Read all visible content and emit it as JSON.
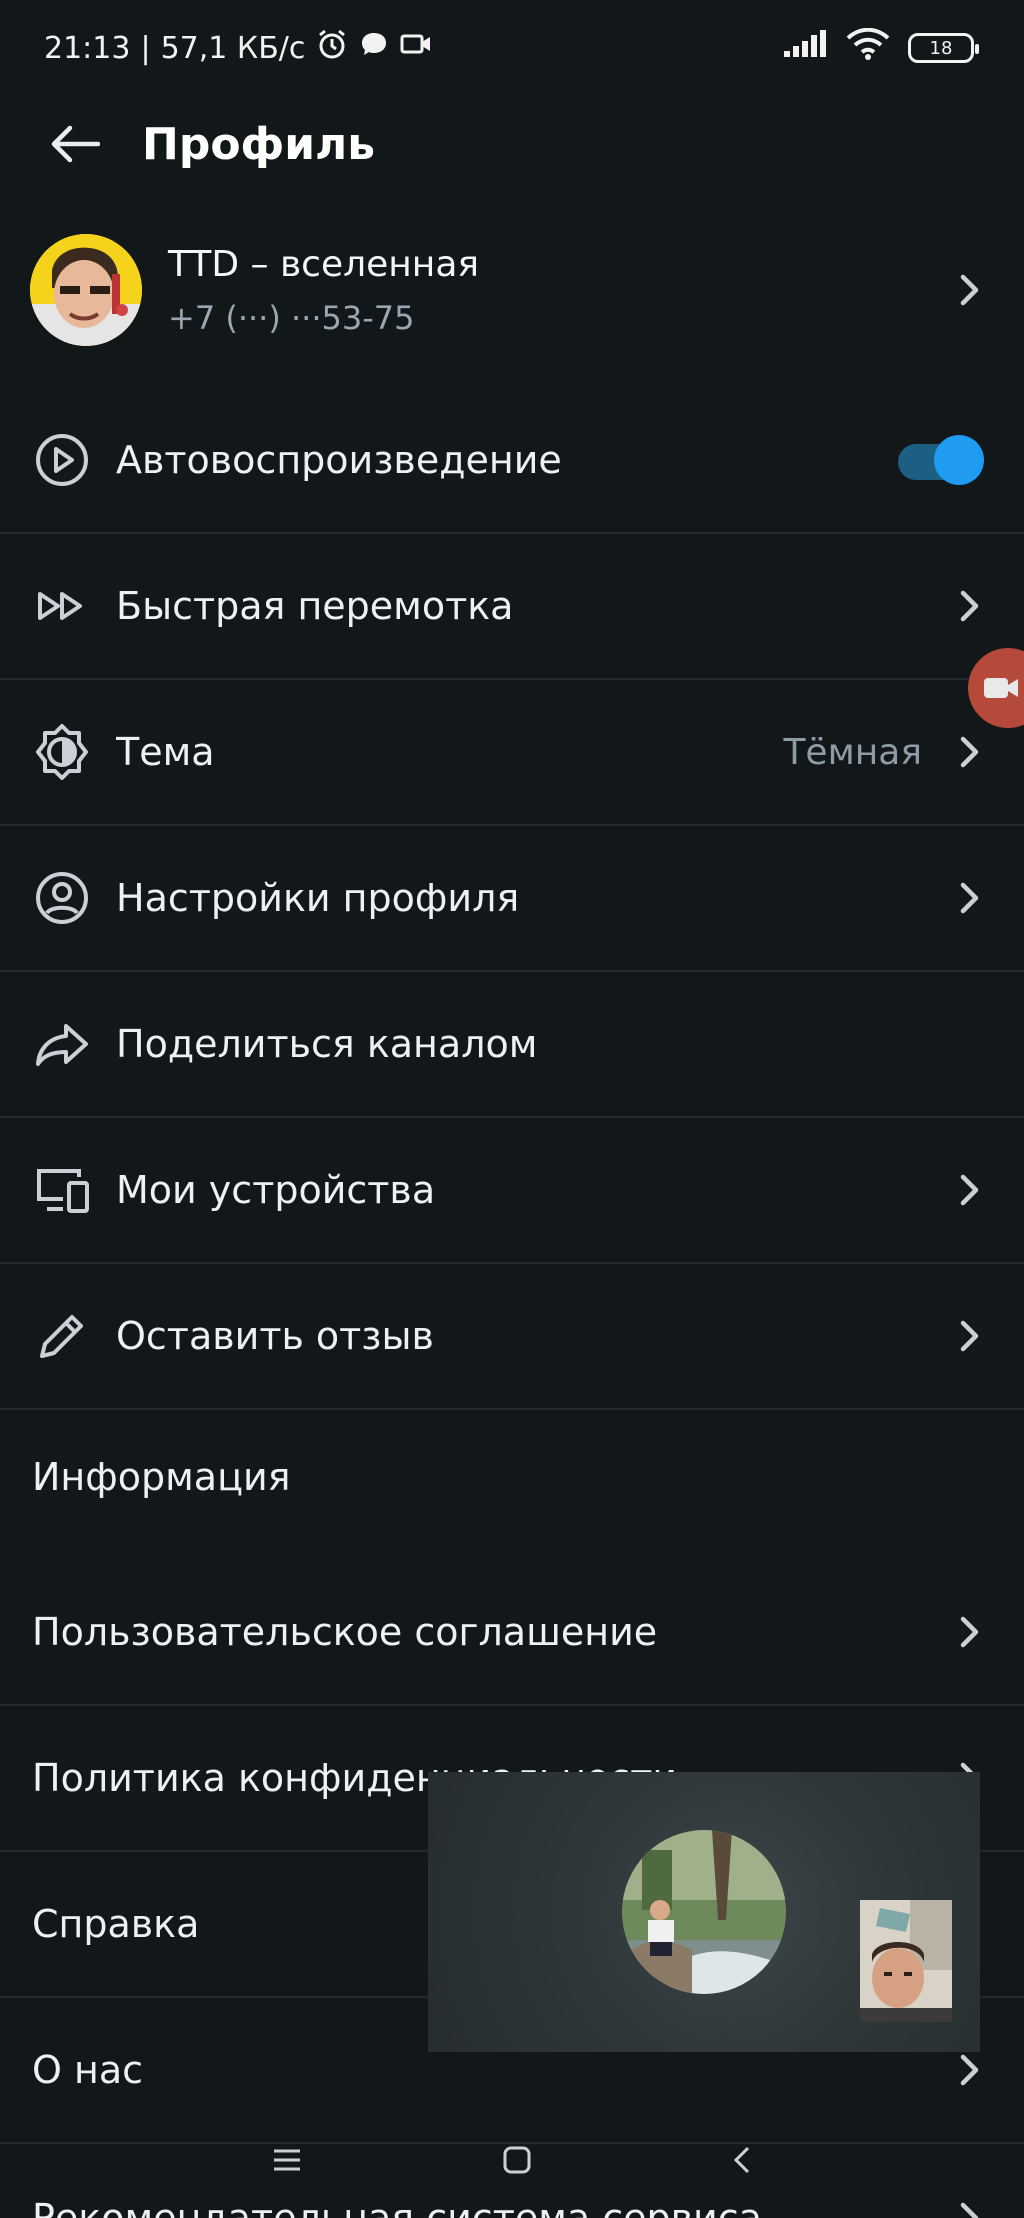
{
  "status_bar": {
    "time": "21:13",
    "speed": "57,1 КБ/с",
    "battery": "18"
  },
  "header": {
    "title": "Профиль"
  },
  "profile": {
    "name": "TTD –  вселенная",
    "phone": "+7 (···) ···53-75"
  },
  "settings": {
    "autoplay": {
      "label": "Автовоспроизведение",
      "enabled": true
    },
    "fast_rewind": {
      "label": "Быстрая перемотка"
    },
    "theme": {
      "label": "Тема",
      "value": "Тёмная"
    },
    "profile_settings": {
      "label": "Настройки профиля"
    },
    "share_channel": {
      "label": "Поделиться каналом"
    },
    "devices": {
      "label": "Мои устройства"
    },
    "feedback": {
      "label": "Оставить отзыв"
    }
  },
  "info": {
    "section_title": "Информация",
    "items": [
      {
        "label": "Пользовательское соглашение"
      },
      {
        "label": "Политика конфиденциальности"
      },
      {
        "label": "Справка"
      },
      {
        "label": "О нас"
      },
      {
        "label": "Рекомендательная система сервиса"
      }
    ]
  },
  "colors": {
    "background": "#12171a",
    "accent": "#1f9bf0",
    "divider": "#232a30",
    "secondary_text": "#9aa7b1"
  }
}
